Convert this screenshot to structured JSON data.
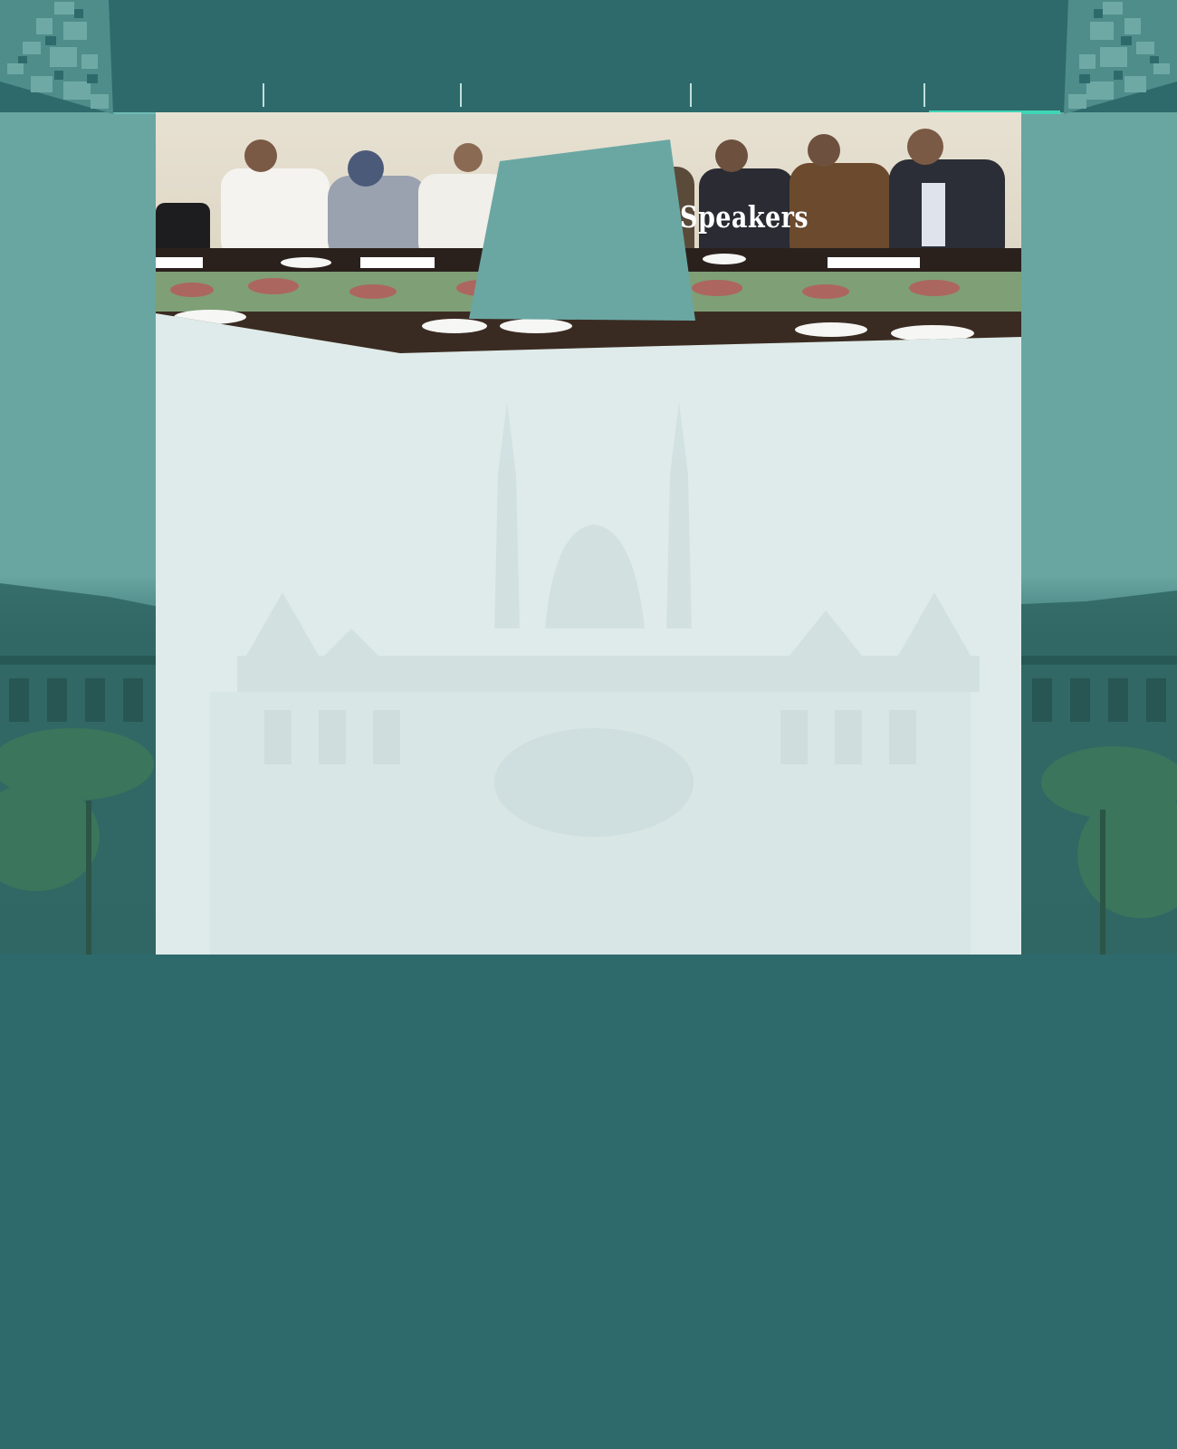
{
  "nav": {
    "items": [
      "",
      "",
      "",
      "",
      ""
    ],
    "active_index": 4
  },
  "page": {
    "heading": "Speakers"
  },
  "colors": {
    "header_bg": "#2e6a6c",
    "panel_bg": "#deebea",
    "accent": "#3fd6b5",
    "heading_shape": "#6aa7a3"
  },
  "icons": {
    "corner_ornament": "pixel-pattern-icon"
  }
}
